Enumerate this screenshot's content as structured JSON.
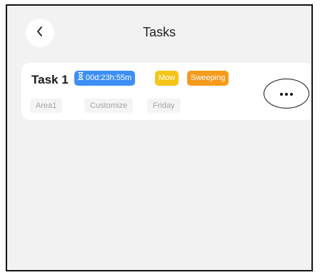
{
  "header": {
    "title": "Tasks",
    "back_icon": "chevron-left-icon"
  },
  "tasks": [
    {
      "name": "Task 1",
      "timer_icon": "hourglass-icon",
      "timer": "00d:23h:55m",
      "tags": [
        "Mow",
        "Sweeping"
      ],
      "area": "Area1",
      "mode": "Customize",
      "day": "Friday",
      "more_icon": "more-dots-icon"
    }
  ],
  "colors": {
    "timer_chip": "#3d8ff5",
    "mow_chip": "#f5c518",
    "sweeping_chip": "#f59a1b",
    "background": "#f2f2f3"
  }
}
